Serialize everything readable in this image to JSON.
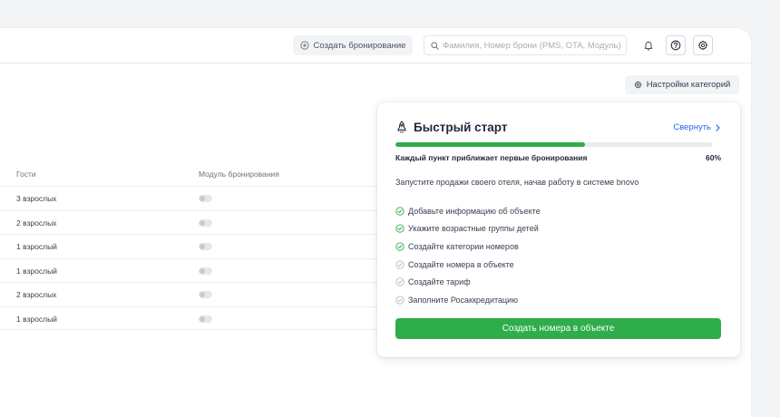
{
  "header": {
    "create_booking_label": "Создать бронирование",
    "search_placeholder": "Фамилия, Номер брони (PMS, OTA, Модуль)"
  },
  "toolbar": {
    "category_settings_label": "Настройки категорий"
  },
  "table": {
    "columns": [
      "Гости",
      "Модуль бронирования"
    ],
    "rows": [
      {
        "guests": "3 взрослых",
        "module_enabled": false
      },
      {
        "guests": "2 взрослых",
        "module_enabled": false
      },
      {
        "guests": "1 взрослый",
        "module_enabled": false
      },
      {
        "guests": "1 взрослый",
        "module_enabled": false
      },
      {
        "guests": "2 взрослых",
        "module_enabled": false
      },
      {
        "guests": "1 взрослый",
        "module_enabled": false
      }
    ]
  },
  "quick_start": {
    "title": "Быстрый старт",
    "collapse_label": "Свернуть",
    "progress_caption": "Каждый пункт приближает первые бронирования",
    "progress_percent": "60%",
    "progress_value": 0.6,
    "description": "Запустите продажи своего отеля, начав работу в системе bnovo",
    "steps": [
      {
        "label": "Добавьте информацию об объекте",
        "done": true
      },
      {
        "label": "Укажите возрастные группы детей",
        "done": true
      },
      {
        "label": "Создайте категории номеров",
        "done": true
      },
      {
        "label": "Создайте номера в объекте",
        "done": false
      },
      {
        "label": "Создайте тариф",
        "done": false
      },
      {
        "label": "Заполните Росаккредитацию",
        "done": false
      }
    ],
    "cta_label": "Создать номера в объекте"
  },
  "colors": {
    "accent_green": "#2fad4a",
    "link_blue": "#2563eb",
    "step_done": "#2fad4a",
    "step_pending": "#b8bdc5"
  }
}
